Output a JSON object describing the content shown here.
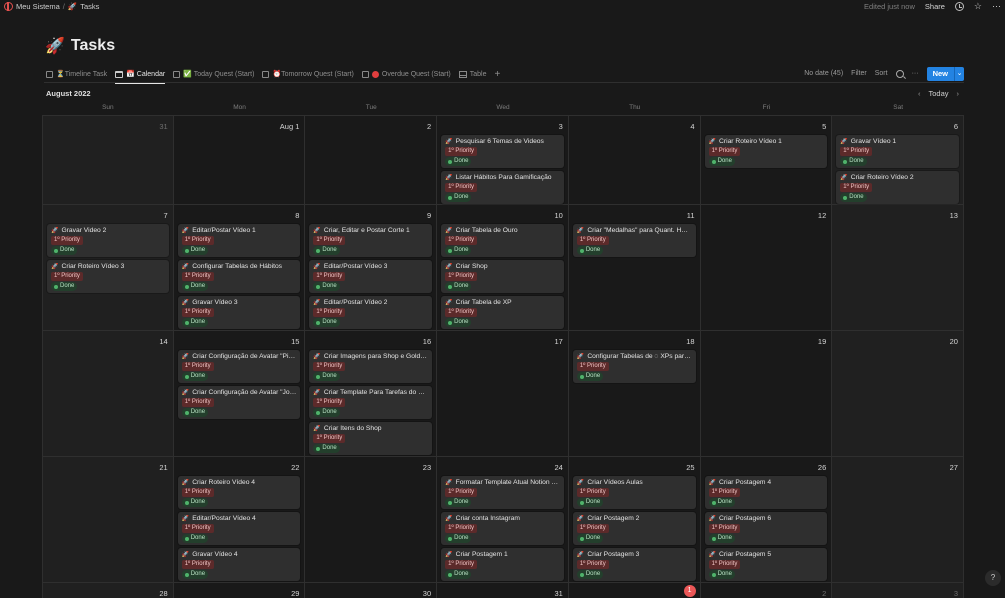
{
  "breadcrumb": {
    "workspace": "Meu Sistema",
    "page_icon": "🚀",
    "page": "Tasks",
    "separator": "/"
  },
  "header": {
    "edited": "Edited just now",
    "share": "Share"
  },
  "title": {
    "icon": "🚀",
    "text": "Tasks"
  },
  "tabs": [
    {
      "label": "⏳Timeline Task",
      "active": false,
      "icon": "view-icon"
    },
    {
      "label": "📅 Calendar",
      "active": true,
      "icon": "calendar-view-icon"
    },
    {
      "label": "✅ Today Quest (Start)",
      "active": false,
      "icon": "view-icon"
    },
    {
      "label": "⏰Tomorrow Quest (Start)",
      "active": false,
      "icon": "view-icon"
    },
    {
      "label": "Overdue Quest (Start)",
      "active": false,
      "icon": "view-icon",
      "dot": "#e03e3e"
    },
    {
      "label": "Table",
      "active": false,
      "icon": "table-view-icon"
    }
  ],
  "toolbar": {
    "no_date": "No date (45)",
    "filter": "Filter",
    "sort": "Sort",
    "more": "···",
    "new": "New",
    "new_caret": "⌄"
  },
  "calendar": {
    "month": "August 2022",
    "today_label": "Today",
    "prev": "‹",
    "next": "›",
    "weekdays": [
      "Sun",
      "Mon",
      "Tue",
      "Wed",
      "Thu",
      "Fri",
      "Sat"
    ],
    "priority_label": "1º Priority",
    "done_label": "Done",
    "weeks": [
      [
        {
          "day": "31",
          "muted": true,
          "tasks": []
        },
        {
          "day": "Aug 1",
          "tasks": []
        },
        {
          "day": "2",
          "tasks": []
        },
        {
          "day": "3",
          "tasks": [
            "Pesquisar 6 Temas de Videos",
            "Listar Hábitos Para Gamificação"
          ]
        },
        {
          "day": "4",
          "tasks": []
        },
        {
          "day": "5",
          "tasks": [
            "Criar Roteiro Vídeo 1"
          ]
        },
        {
          "day": "6",
          "tasks": [
            "Gravar Vídeo 1",
            "Criar Roteiro Vídeo 2"
          ]
        }
      ],
      [
        {
          "day": "7",
          "tasks": [
            "Gravar Video 2",
            "Criar Roteiro Vídeo 3"
          ]
        },
        {
          "day": "8",
          "tasks": [
            "Editar/Postar Vídeo 1",
            "Configurar Tabelas de Hábitos",
            "Gravar Vídeo 3"
          ]
        },
        {
          "day": "9",
          "tasks": [
            "Criar, Editar e Postar Corte 1",
            "Editar/Postar Vídeo 3",
            "Editar/Postar Vídeo 2"
          ]
        },
        {
          "day": "10",
          "tasks": [
            "Criar Tabela de Ouro",
            "Criar Shop",
            "Criar Tabela de XP"
          ]
        },
        {
          "day": "11",
          "tasks": [
            "Criar \"Medalhas\" para Quant. Hábitos"
          ]
        },
        {
          "day": "12",
          "tasks": []
        },
        {
          "day": "13",
          "tasks": []
        }
      ],
      [
        {
          "day": "14",
          "tasks": []
        },
        {
          "day": "15",
          "tasks": [
            "Criar Configuração de Avatar \"Pilares\".",
            "Criar Configuração de Avatar \"Jornada\""
          ]
        },
        {
          "day": "16",
          "tasks": [
            "Criar Imagens para Shop e Gold Bag",
            "Criar Template Para Tarefas do Projeto",
            "Criar Itens do Shop"
          ]
        },
        {
          "day": "17",
          "tasks": []
        },
        {
          "day": "18",
          "tasks": [
            "Configurar Tabelas de ◌ XPs para Epic"
          ]
        },
        {
          "day": "19",
          "tasks": []
        },
        {
          "day": "20",
          "tasks": []
        }
      ],
      [
        {
          "day": "21",
          "tasks": []
        },
        {
          "day": "22",
          "tasks": [
            "Criar Roteiro Vídeo 4",
            "Editar/Postar Vídeo 4",
            "Gravar Vídeo 4"
          ]
        },
        {
          "day": "23",
          "tasks": []
        },
        {
          "day": "24",
          "tasks": [
            "Formatar Template Atual Notion Para Venda",
            "Criar conta Instagram",
            "Criar Postagem 1"
          ]
        },
        {
          "day": "25",
          "tasks": [
            "Criar Vídeos Aulas",
            "Criar Postagem 2",
            "Criar Postagem 3"
          ]
        },
        {
          "day": "26",
          "tasks": [
            "Criar Postagem 4",
            "Criar Postagem 6",
            "Criar Postagem 5"
          ]
        },
        {
          "day": "27",
          "tasks": []
        }
      ],
      [
        {
          "day": "28",
          "tasks": []
        },
        {
          "day": "29",
          "tasks": []
        },
        {
          "day": "30",
          "tasks": []
        },
        {
          "day": "31",
          "tasks": []
        },
        {
          "day": "1",
          "today": true,
          "tasks": []
        },
        {
          "day": "2",
          "muted": true,
          "tasks": []
        },
        {
          "day": "3",
          "muted": true,
          "tasks": []
        }
      ]
    ]
  },
  "help": "?"
}
